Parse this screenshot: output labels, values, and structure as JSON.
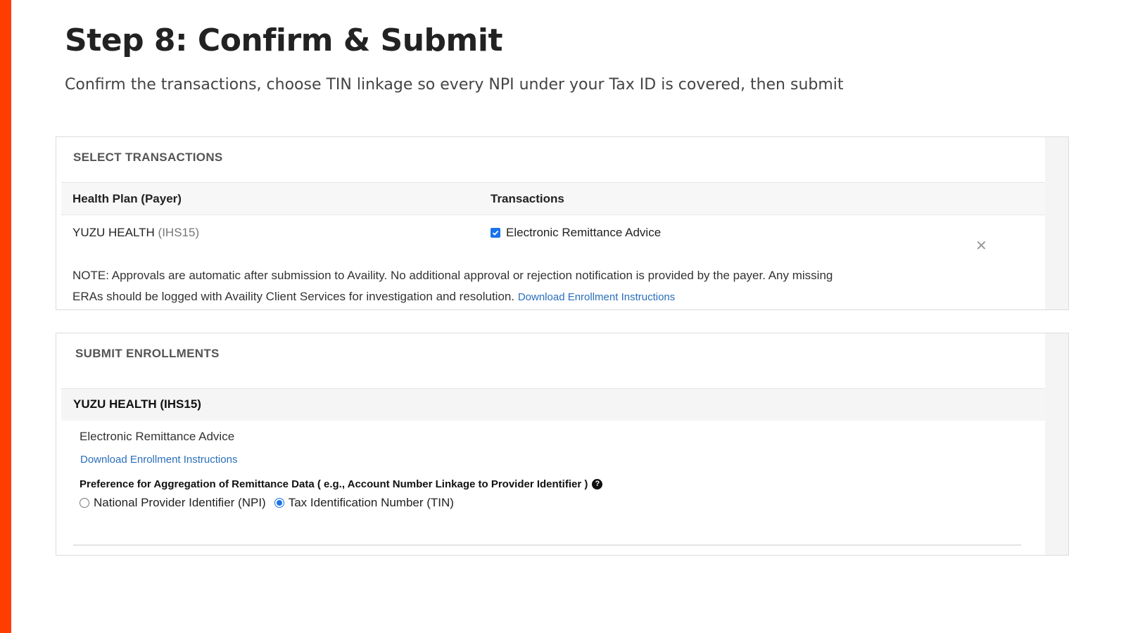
{
  "page": {
    "title": "Step 8: Confirm & Submit",
    "subtitle": "Confirm the transactions, choose TIN linkage so every NPI under your Tax ID is covered, then submit",
    "accent_color": "#ff3d00"
  },
  "select_transactions": {
    "header": "SELECT TRANSACTIONS",
    "columns": [
      "Health Plan (Payer)",
      "Transactions"
    ],
    "rows": [
      {
        "payer_name": "YUZU HEALTH",
        "payer_code": "(IHS15)",
        "transaction": "Electronic Remittance Advice",
        "checked": true
      }
    ],
    "close_icon": "close-icon",
    "note_text": "NOTE: Approvals are automatic after submission to Availity. No additional approval or rejection notification is provided by the payer. Any missing ERAs should be logged with Availity Client Services for investigation and resolution.",
    "note_link": "Download Enrollment Instructions"
  },
  "submit_enrollments": {
    "header": "SUBMIT ENROLLMENTS",
    "payer_title": "YUZU HEALTH (IHS15)",
    "transaction": "Electronic Remittance Advice",
    "download_link": "Download Enrollment Instructions",
    "preference_label": "Preference for Aggregation of Remittance Data ( e.g., Account Number Linkage to Provider Identifier )",
    "help_icon": "question-circle-icon",
    "options": [
      {
        "label": "National Provider Identifier (NPI)",
        "selected": false
      },
      {
        "label": "Tax Identification Number (TIN)",
        "selected": true
      }
    ]
  },
  "colors": {
    "link": "#2a6ebb",
    "control_blue": "#1a73e8"
  }
}
